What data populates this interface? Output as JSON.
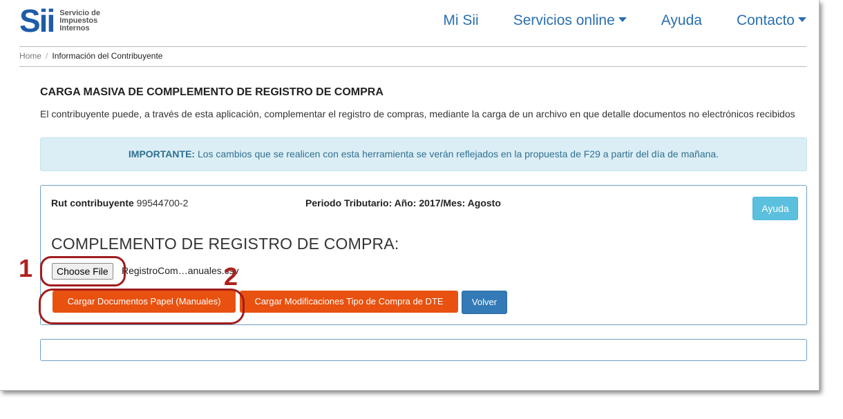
{
  "logo": {
    "mark": "Sii",
    "line1": "Servicio de",
    "line2": "Impuestos",
    "line3": "Internos"
  },
  "nav": {
    "mi_sii": "Mi Sii",
    "servicios": "Servicios online",
    "ayuda": "Ayuda",
    "contacto": "Contacto"
  },
  "breadcrumb": {
    "home": "Home",
    "separator": "/",
    "current": "Información del Contribuyente"
  },
  "page": {
    "title": "CARGA MASIVA DE COMPLEMENTO DE REGISTRO DE COMPRA",
    "description": "El contribuyente puede, a través de esta aplicación, complementar el registro de compras, mediante la carga de un archivo en que detalle documentos no electrónicos recibidos"
  },
  "alert": {
    "label": "IMPORTANTE:",
    "text": " Los cambios que se realicen con esta herramienta se verán reflejados en la propuesta de F29 a partir del día de mañana."
  },
  "panel": {
    "rut_label": "Rut contribuyente",
    "rut_value": "99544700-2",
    "periodo": "Periodo Tributario: Año: 2017/Mes: Agosto",
    "help_button": "Ayuda",
    "section_title": "COMPLEMENTO DE REGISTRO DE COMPRA:",
    "choose_file": "Choose File",
    "file_name": "RegistroCom…anuales.csv",
    "btn_cargar_papel": "Cargar Documentos Papel (Manuales)",
    "btn_cargar_modificaciones": "Cargar Modificaciones Tipo de Compra de DTE",
    "btn_volver": "Volver"
  },
  "annotations": {
    "step1": "1",
    "step2": "2"
  },
  "colors": {
    "brand": "#1e5ca8",
    "orange": "#e8510f",
    "blue_btn": "#337ab7",
    "info": "#5bc0de",
    "annotation": "#a01c1c"
  }
}
